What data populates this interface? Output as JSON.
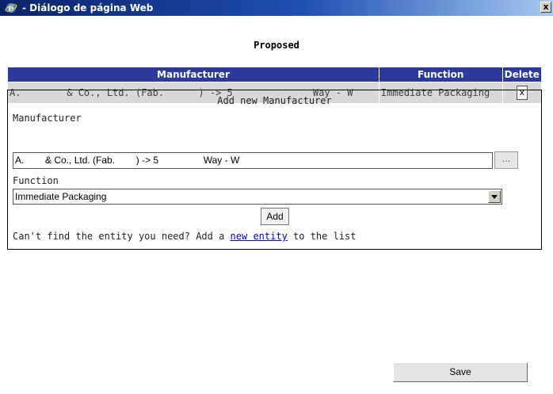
{
  "window": {
    "title": "- Diálogo de página Web",
    "close_label": "x"
  },
  "heading": "Proposed",
  "table": {
    "headers": [
      "Manufacturer",
      "Function",
      "Delete"
    ],
    "rows": [
      {
        "manufacturer": "A.        & Co., Ltd. (Fab.      ) -> 5              Way - W",
        "function": "Immediate Packaging",
        "delete_label": "x"
      }
    ]
  },
  "panel": {
    "title": "Add new Manufacturer",
    "manufacturer_label": "Manufacturer",
    "manufacturer_value": "A.        & Co., Ltd. (Fab.        ) -> 5                 Way - W",
    "browse_label": "...",
    "function_label": "Function",
    "function_value": "Immediate Packaging",
    "add_label": "Add",
    "help_prefix": "Can't find the entity you need? Add a ",
    "help_link": "new entity",
    "help_suffix": " to the list"
  },
  "save_label": "Save",
  "colors": {
    "header_bg": "#2b3a9c",
    "row_bg": "#d8d8d8",
    "titlebar_start": "#0a246a",
    "link": "#0000cc"
  }
}
